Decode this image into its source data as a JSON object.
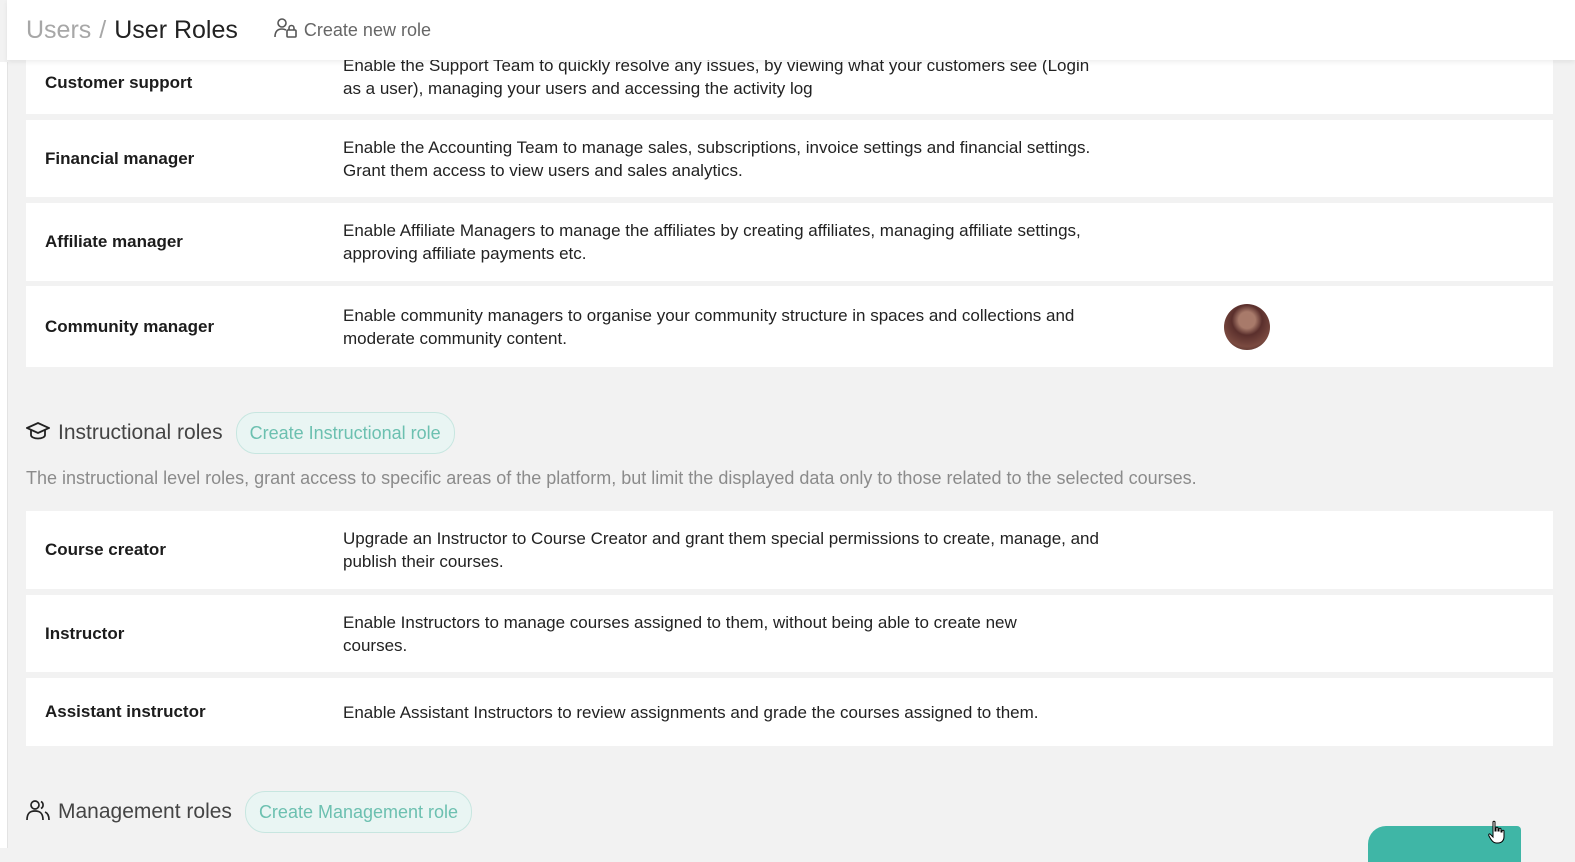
{
  "header": {
    "breadcrumb_parent": "Users",
    "breadcrumb_separator": "/",
    "breadcrumb_current": "User Roles",
    "create_new_role": "Create new role"
  },
  "top_roles": [
    {
      "name": "Customer support",
      "description": "Enable the Support Team to quickly resolve any issues, by viewing what your customers see (Login as a user), managing your users and accessing the activity log"
    },
    {
      "name": "Financial manager",
      "description": "Enable the Accounting Team to manage sales, subscriptions, invoice settings and financial settings. Grant them access to view users and sales analytics."
    },
    {
      "name": "Affiliate manager",
      "description": "Enable Affiliate Managers to manage the affiliates by creating affiliates, managing affiliate settings, approving affiliate payments etc."
    },
    {
      "name": "Community manager",
      "description": "Enable community managers to organise your community structure in spaces and collections and moderate community content."
    }
  ],
  "instructional": {
    "title": "Instructional roles",
    "create_label": "Create Instructional role",
    "intro": "The instructional level roles, grant access to specific areas of the platform, but limit the displayed data only to those related to the selected courses.",
    "roles": [
      {
        "name": "Course creator",
        "description": "Upgrade an Instructor to Course Creator and grant them special permissions to create, manage, and publish their courses."
      },
      {
        "name": "Instructor",
        "description": "Enable Instructors to manage courses assigned to them, without being able to create new courses."
      },
      {
        "name": "Assistant instructor",
        "description": "Enable Assistant Instructors to review assignments and grade the courses assigned to them."
      }
    ]
  },
  "management": {
    "title": "Management roles",
    "create_label": "Create Management role"
  },
  "icons": {
    "create_role": "user-lock-icon",
    "instructional": "graduation-cap-icon",
    "management": "users-icon"
  },
  "colors": {
    "accent": "#3fb6a6",
    "pill_bg": "#e9f5f3",
    "pill_text": "#6cc0b0"
  }
}
